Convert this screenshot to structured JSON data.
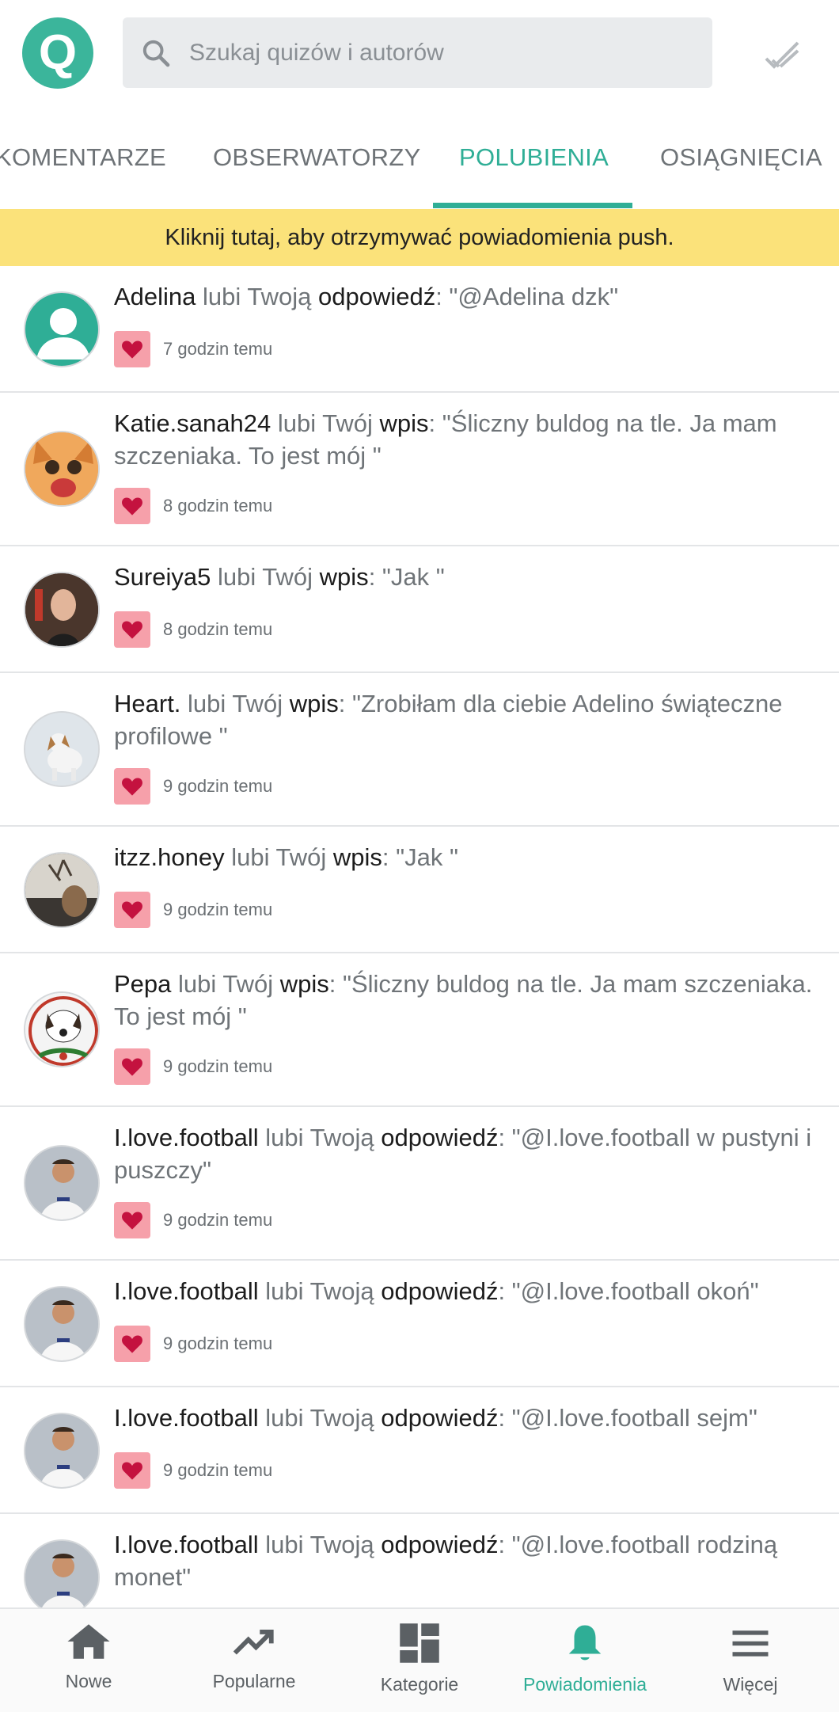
{
  "header": {
    "logo_letter": "Q",
    "search_placeholder": "Szukaj quizów i autorów"
  },
  "tabs": [
    {
      "label": "KOMENTARZE"
    },
    {
      "label": "OBSERWATORZY"
    },
    {
      "label": "POLUBIENIA"
    },
    {
      "label": "OSIĄGNIĘCIA"
    }
  ],
  "active_tab": "POLUBIENIA",
  "banner": {
    "text": "Kliknij tutaj, aby otrzymywać powiadomienia push."
  },
  "notifications": [
    {
      "user": "Adelina",
      "verb": "lubi Twoją",
      "kind": "odpowiedź",
      "quote": ": \"@Adelina dzk\"",
      "time": "7 godzin temu"
    },
    {
      "user": "Katie.sanah24",
      "verb": "lubi Twój",
      "kind": "wpis",
      "quote": ": \"Śliczny buldog na tle. Ja mam szczeniaka. To jest mój \"",
      "time": "8 godzin temu"
    },
    {
      "user": "Sureiya5",
      "verb": "lubi Twój",
      "kind": "wpis",
      "quote": ": \"Jak \"",
      "time": "8 godzin temu"
    },
    {
      "user": "Heart.",
      "verb": "lubi Twój",
      "kind": "wpis",
      "quote": ": \"Zrobiłam dla ciebie Adelino świąteczne profilowe \"",
      "time": "9 godzin temu"
    },
    {
      "user": "itzz.honey",
      "verb": "lubi Twój",
      "kind": "wpis",
      "quote": ": \"Jak \"",
      "time": "9 godzin temu"
    },
    {
      "user": "Pepa",
      "verb": "lubi Twój",
      "kind": "wpis",
      "quote": ": \"Śliczny buldog na tle. Ja mam szczeniaka. To jest mój \"",
      "time": "9 godzin temu"
    },
    {
      "user": "I.love.football",
      "verb": "lubi Twoją",
      "kind": "odpowiedź",
      "quote": ": \"@I.love.football w pustyni i puszczy\"",
      "time": "9 godzin temu"
    },
    {
      "user": "I.love.football",
      "verb": "lubi Twoją",
      "kind": "odpowiedź",
      "quote": ": \"@I.love.football okoń\"",
      "time": "9 godzin temu"
    },
    {
      "user": "I.love.football",
      "verb": "lubi Twoją",
      "kind": "odpowiedź",
      "quote": ": \"@I.love.football sejm\"",
      "time": "9 godzin temu"
    },
    {
      "user": "I.love.football",
      "verb": "lubi Twoją",
      "kind": "odpowiedź",
      "quote": ": \"@I.love.football rodziną monet\"",
      "time": ""
    }
  ],
  "bottom_nav": [
    {
      "label": "Nowe",
      "icon": "home-icon"
    },
    {
      "label": "Popularne",
      "icon": "trending-icon"
    },
    {
      "label": "Kategorie",
      "icon": "categories-icon"
    },
    {
      "label": "Powiadomienia",
      "icon": "bell-icon"
    },
    {
      "label": "Więcej",
      "icon": "menu-icon"
    }
  ],
  "colors": {
    "accent": "#2fae96",
    "banner": "#fbe27a",
    "heart_bg": "#f6a0aa",
    "heart": "#c4123f"
  }
}
